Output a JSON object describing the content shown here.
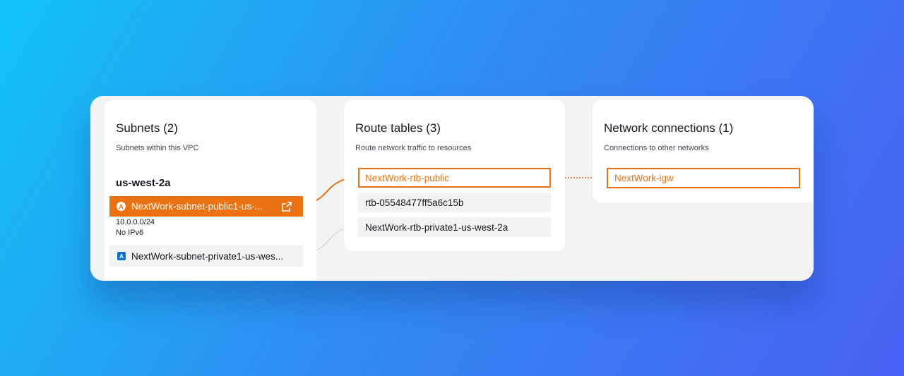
{
  "colors": {
    "accent": "#ec7211",
    "badge_private": "#0972d3",
    "connector_idle": "#d5dbdb"
  },
  "subnets": {
    "title": "Subnets (2)",
    "subtitle": "Subnets within this VPC",
    "availability_zone": "us-west-2a",
    "public": {
      "badge": "A",
      "label": "NextWork-subnet-public1-us-...",
      "cidr": "10.0.0.0/24",
      "ipv6": "No IPv6",
      "icon": "external-link-icon"
    },
    "private": {
      "badge": "A",
      "label": "NextWork-subnet-private1-us-wes..."
    }
  },
  "route_tables": {
    "title": "Route tables (3)",
    "subtitle": "Route network traffic to resources",
    "items": [
      "NextWork-rtb-public",
      "rtb-05548477ff5a6c15b",
      "NextWork-rtb-private1-us-west-2a"
    ]
  },
  "network_connections": {
    "title": "Network connections (1)",
    "subtitle": "Connections to other networks",
    "items": [
      "NextWork-igw"
    ]
  }
}
